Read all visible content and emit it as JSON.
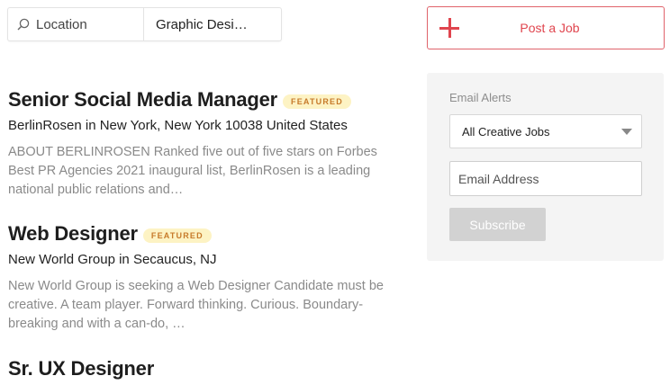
{
  "search": {
    "location_placeholder": "Location",
    "keyword_value": "Graphic Desi…"
  },
  "post_job": {
    "label": "Post a Job"
  },
  "jobs": [
    {
      "title": "Senior Social Media Manager",
      "badge": "FEATURED",
      "company": "BerlinRosen in New York, New York 10038 United States",
      "description": "ABOUT BERLINROSEN Ranked five out of five stars on Forbes Best PR Agencies 2021 inaugural list, BerlinRosen is a leading national public relations and…"
    },
    {
      "title": "Web Designer",
      "badge": "FEATURED",
      "company": "New World Group in Secaucus, NJ",
      "description": "New World Group is seeking a Web Designer Candidate must be creative. A team player. Forward thinking. Curious. Boundary-breaking and with a can-do, …"
    },
    {
      "title": "Sr. UX Designer"
    }
  ],
  "alerts": {
    "title": "Email Alerts",
    "select_value": "All Creative Jobs",
    "email_placeholder": "Email Address",
    "subscribe_label": "Subscribe"
  },
  "colors": {
    "accent": "#e0454e",
    "badge_bg": "#fdf3c4",
    "badge_text": "#c77a2a"
  }
}
